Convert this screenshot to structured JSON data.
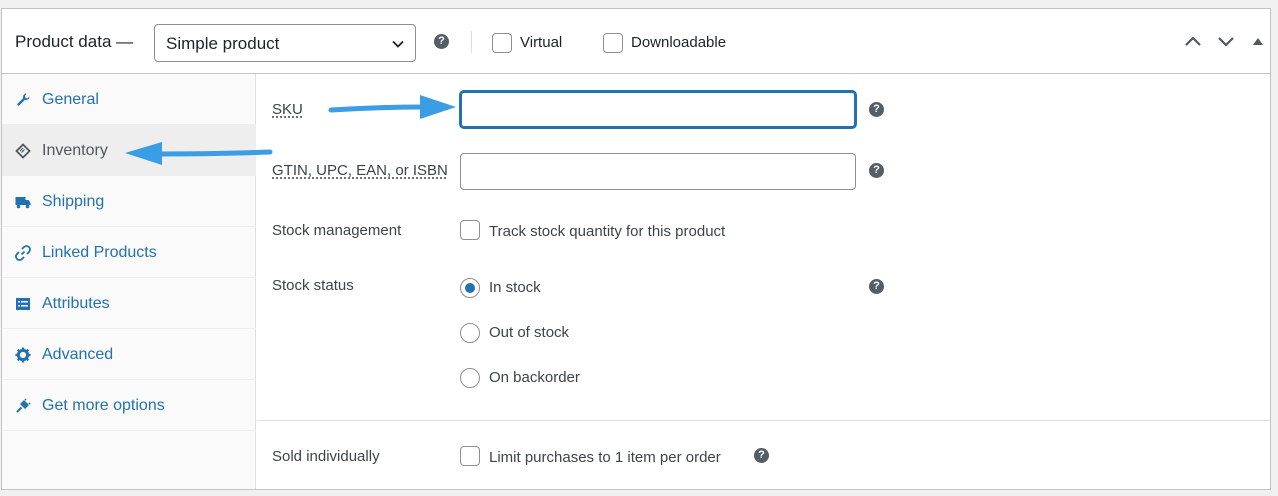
{
  "header": {
    "title": "Product data —",
    "product_type": "Simple product",
    "virtual_label": "Virtual",
    "downloadable_label": "Downloadable"
  },
  "tabs": [
    {
      "label": "General",
      "icon": "wrench-icon"
    },
    {
      "label": "Inventory",
      "icon": "tag-icon",
      "active": true
    },
    {
      "label": "Shipping",
      "icon": "truck-icon"
    },
    {
      "label": "Linked Products",
      "icon": "link-icon"
    },
    {
      "label": "Attributes",
      "icon": "list-icon"
    },
    {
      "label": "Advanced",
      "icon": "gear-icon"
    },
    {
      "label": "Get more options",
      "icon": "plugin-icon"
    }
  ],
  "inventory": {
    "sku_label": "SKU",
    "sku_value": "",
    "gtin_label": "GTIN, UPC, EAN, or ISBN",
    "gtin_value": "",
    "stock_management_label": "Stock management",
    "track_stock_label": "Track stock quantity for this product",
    "stock_status_label": "Stock status",
    "stock_options": [
      "In stock",
      "Out of stock",
      "On backorder"
    ],
    "stock_selected": "In stock",
    "sold_individually_label": "Sold individually",
    "limit_purchases_label": "Limit purchases to 1 item per order"
  },
  "annotations": {
    "arrow_color": "#3a9de6"
  },
  "colors": {
    "link": "#2271b1",
    "border": "#c3c4c7"
  }
}
